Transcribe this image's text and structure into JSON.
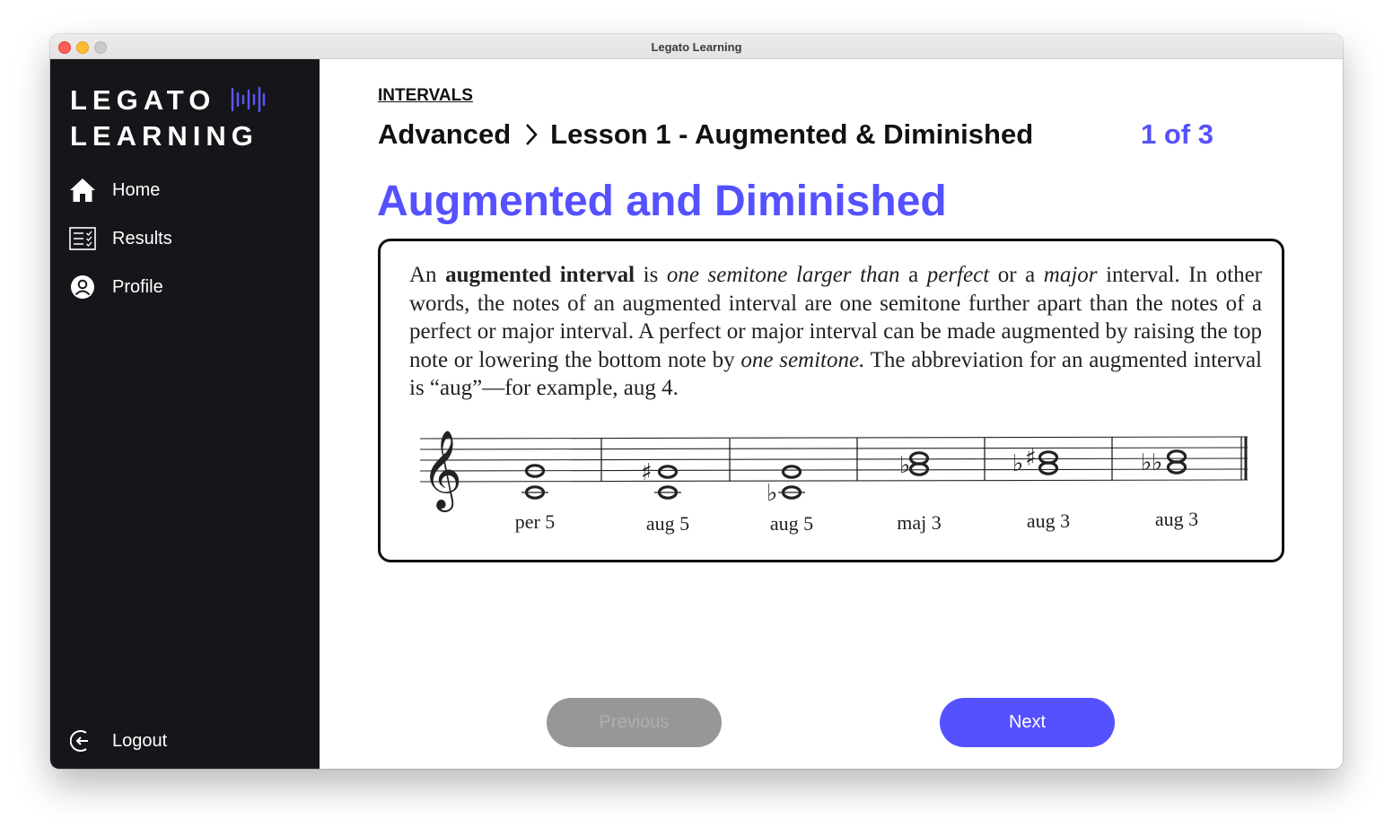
{
  "window": {
    "title": "Legato Learning"
  },
  "brand": {
    "line1": "LEGATO",
    "line2": "LEARNING"
  },
  "sidebar": {
    "items": [
      {
        "label": "Home",
        "icon": "home-icon"
      },
      {
        "label": "Results",
        "icon": "results-list-icon"
      },
      {
        "label": "Profile",
        "icon": "profile-icon"
      }
    ],
    "logout": {
      "label": "Logout",
      "icon": "logout-icon"
    }
  },
  "header": {
    "section": "INTERVALS",
    "breadcrumb": {
      "level": "Advanced",
      "lesson": "Lesson 1 - Augmented & Diminished"
    },
    "page_count": "1 of 3"
  },
  "lesson": {
    "title": "Augmented and Diminished",
    "text": {
      "p1": "An ",
      "b1": "augmented interval",
      "p2": " is ",
      "i1": "one semitone larger than",
      "p3": " a ",
      "i2": "perfect",
      "p4": " or a ",
      "i3": "major",
      "p5": " interval. In other words, the notes of an augmented interval are one semitone further apart than the notes of a perfect or major interval. A perfect or major interval can be made augmented by raising the top note or lowering the bottom note by ",
      "i4": "one semitone.",
      "p6": " The abbreviation for an augmented interval is “aug”—for example, aug 4."
    },
    "examples": [
      "per 5",
      "aug 5",
      "aug 5",
      "maj 3",
      "aug 3",
      "aug 3"
    ]
  },
  "nav": {
    "previous": "Previous",
    "next": "Next",
    "previous_enabled": false
  },
  "colors": {
    "accent": "#5551ff",
    "sidebar_bg": "#16161a",
    "disabled": "#979797"
  }
}
